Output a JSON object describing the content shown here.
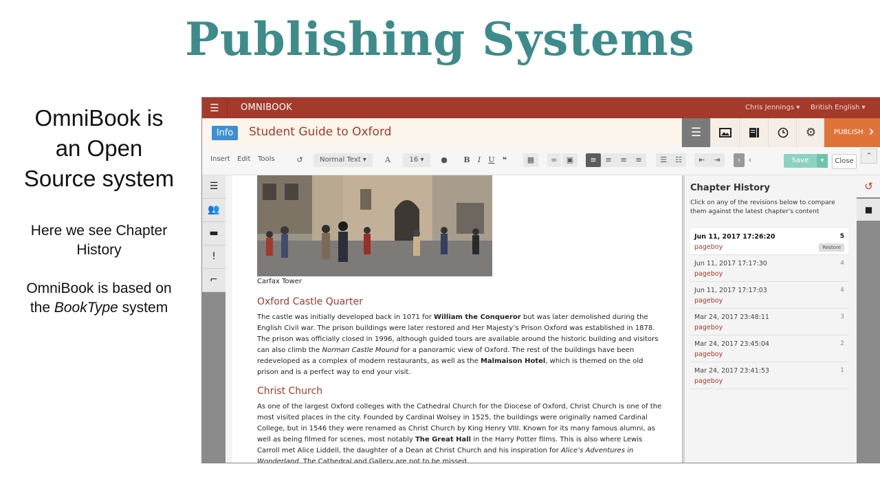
{
  "slide": {
    "title": "Publishing Systems",
    "intro_lines": [
      "OmniBook is",
      "an Open",
      "Source system"
    ],
    "note1_lines": [
      "Here we see Chapter",
      "History"
    ],
    "note2_line1": "OmniBook is based on",
    "note2_prefix": "the ",
    "note2_em": "BookType",
    "note2_suffix": " system"
  },
  "app": {
    "brand": "OMNIBOOK",
    "user_menu": "Chris Jennings",
    "language_menu": "British English",
    "info_button": "Info",
    "book_title": "Student Guide to Oxford",
    "publish_label": "PUBLISH",
    "toolbar": {
      "insert": "Insert",
      "edit": "Edit",
      "tools": "Tools",
      "style_select": "Normal Text",
      "font_size": "16",
      "save": "Save",
      "close": "Close"
    },
    "content": {
      "photo_caption": "Carfax Tower",
      "section1_heading": "Oxford Castle Quarter",
      "section1_text": [
        {
          "t": "The castle was initially developed back in 1071 for "
        },
        {
          "t": "William the Conqueror",
          "s": "b"
        },
        {
          "t": " but was later demolished during the English Civil war. The prison buildings were later restored and Her Majesty’s Prison Oxford was established in 1878. The prison was officially closed in 1996, although guided tours are available around the historic building and visitors can also climb the "
        },
        {
          "t": "Norman Castle Mound",
          "s": "i"
        },
        {
          "t": " for a panoramic view of Oxford. The rest of the buildings have been redeveloped as a complex of modern restaurants, as well as the "
        },
        {
          "t": "Malmaison Hotel",
          "s": "b"
        },
        {
          "t": ", which is themed on the old prison and is a perfect way to end your visit."
        }
      ],
      "section2_heading": "Christ Church",
      "section2_text": [
        {
          "t": "As one of the largest Oxford colleges with the Cathedral Church for the Diocese of Oxford, Christ Church is one of the most visited places in the city. Founded by Cardinal Wolsey in 1525, the buildings were originally named Cardinal College, but in 1546 they were renamed as Christ Church by King Henry VIII. Known for its many famous alumni, as well as being filmed for scenes, most notably "
        },
        {
          "t": "The Great Hall",
          "s": "b"
        },
        {
          "t": " in the Harry Potter films. This is also where Lewis Carroll met Alice Liddell, the daughter of a Dean at Christ Church and his inspiration for "
        },
        {
          "t": "Alice’s Adventures in Wonderland",
          "s": "i"
        },
        {
          "t": ". The Cathedral and Gallery are not to be missed."
        }
      ]
    },
    "history": {
      "title": "Chapter History",
      "description": "Click on any of the revisions below to compare them against the latest chapter's content",
      "restore_label": "Restore",
      "revisions": [
        {
          "date": "Jun 11, 2017 17:26:20",
          "user": "pageboy",
          "number": "5",
          "current": true
        },
        {
          "date": "Jun 11, 2017 17:17:30",
          "user": "pageboy",
          "number": "4",
          "current": false
        },
        {
          "date": "Jun 11, 2017 17:17:03",
          "user": "pageboy",
          "number": "4",
          "current": false
        },
        {
          "date": "Mar 24, 2017 23:48:11",
          "user": "pageboy",
          "number": "3",
          "current": false
        },
        {
          "date": "Mar 24, 2017 23:45:04",
          "user": "pageboy",
          "number": "2",
          "current": false
        },
        {
          "date": "Mar 24, 2017 23:41:53",
          "user": "pageboy",
          "number": "1",
          "current": false
        }
      ]
    },
    "colors": {
      "title_teal": "#3d8b8a",
      "brand_red": "#a33a2b",
      "publish_orange": "#e0733a",
      "info_blue": "#3c8fd1",
      "save_teal": "#8bd3c1"
    },
    "icons": {
      "menu": "hamburger-icon",
      "chapters": "list-icon",
      "images": "images-icon",
      "book": "book-icon",
      "history": "clock-icon",
      "settings": "gear-icon"
    }
  }
}
